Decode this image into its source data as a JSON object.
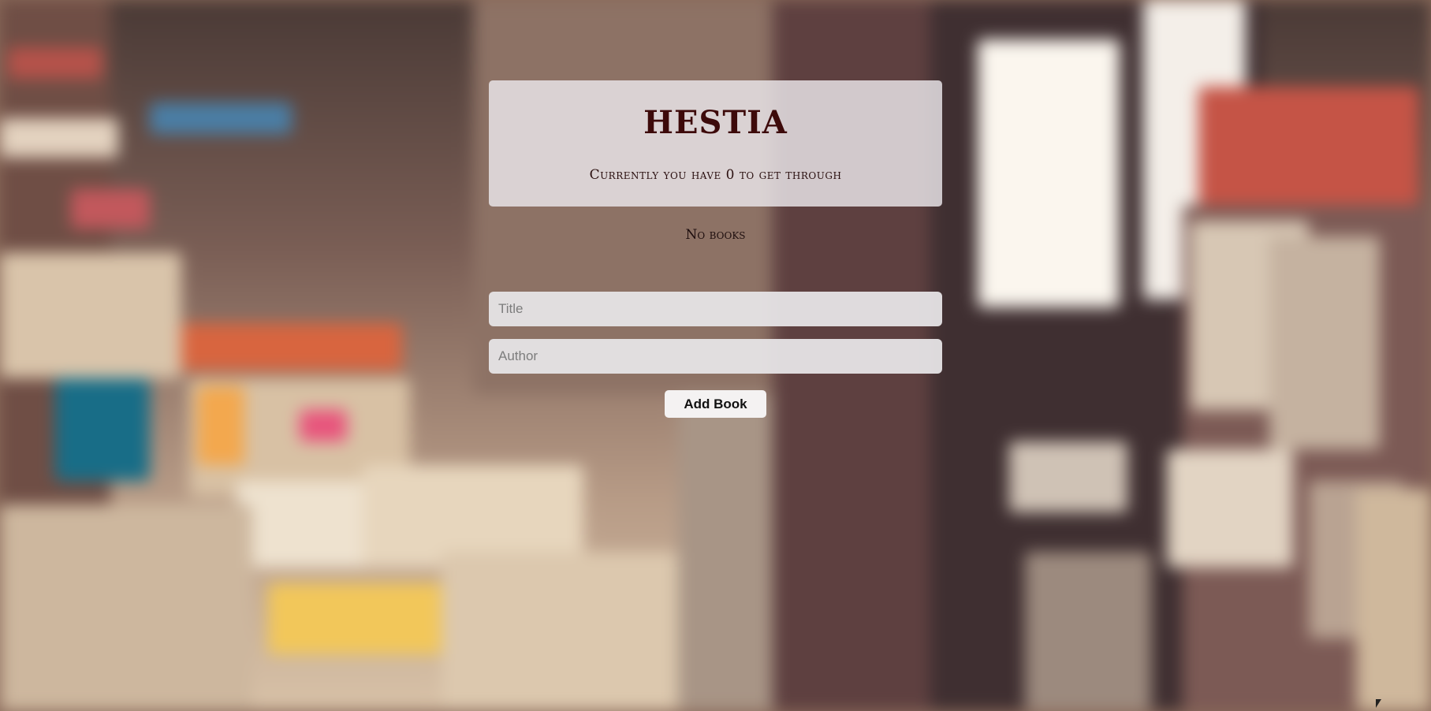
{
  "header": {
    "title": "HESTIA",
    "subtitle": "Currently you have 0 to get through"
  },
  "books": {
    "empty_text": "No books"
  },
  "form": {
    "title_placeholder": "Title",
    "author_placeholder": "Author",
    "add_label": "Add Book"
  },
  "colors": {
    "title": "#3d0a0a",
    "panel": "#ebe8ec",
    "field": "#e6e4e6",
    "button": "#f4f2f2"
  }
}
